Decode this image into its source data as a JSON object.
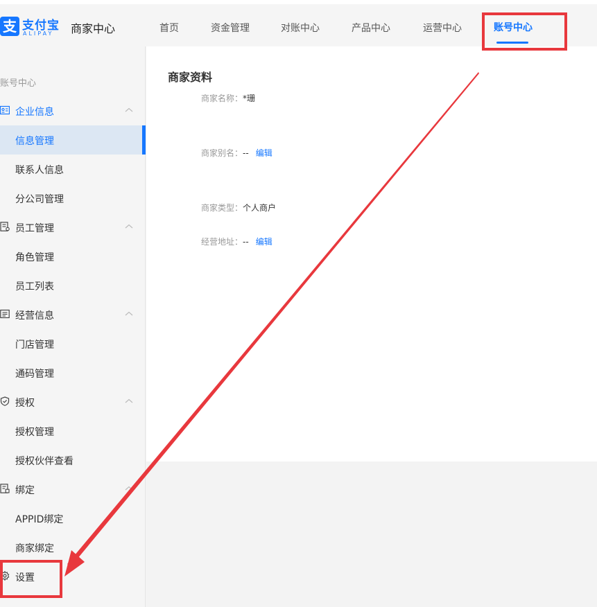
{
  "header": {
    "logo_mark": "支",
    "logo_text": "支付宝",
    "logo_sub": "ALIPAY",
    "site_name": "商家中心",
    "nav": [
      {
        "label": "首页"
      },
      {
        "label": "资金管理"
      },
      {
        "label": "对账中心"
      },
      {
        "label": "产品中心"
      },
      {
        "label": "运营中心"
      },
      {
        "label": "账号中心",
        "active": true
      }
    ]
  },
  "sidebar": {
    "title": "账号中心",
    "groups": [
      {
        "label": "企业信息",
        "icon": "id-card-icon",
        "active": true,
        "items": [
          "信息管理",
          "联系人信息",
          "分公司管理"
        ],
        "selected_item": "信息管理"
      },
      {
        "label": "员工管理",
        "icon": "staff-icon",
        "items": [
          "角色管理",
          "员工列表"
        ]
      },
      {
        "label": "经营信息",
        "icon": "list-icon",
        "items": [
          "门店管理",
          "通码管理"
        ]
      },
      {
        "label": "授权",
        "icon": "shield-icon",
        "items": [
          "授权管理",
          "授权伙伴查看"
        ]
      },
      {
        "label": "绑定",
        "icon": "bind-icon",
        "items": [
          "APPID绑定",
          "商家绑定"
        ]
      },
      {
        "label": "设置",
        "icon": "gear-icon",
        "items": []
      }
    ]
  },
  "main": {
    "title": "商家资料",
    "fields": [
      {
        "key": "商家名称：",
        "value": "*珊",
        "edit": ""
      },
      {
        "key": "商家别名：",
        "value": "--",
        "edit": "编辑"
      },
      {
        "key": "商家类型：",
        "value": "个人商户",
        "edit": ""
      },
      {
        "key": "经营地址：",
        "value": "--",
        "edit": "编辑"
      }
    ]
  },
  "colors": {
    "accent": "#1677ff",
    "annotation": "#e8383d",
    "selected_bg": "#dce7f3"
  }
}
